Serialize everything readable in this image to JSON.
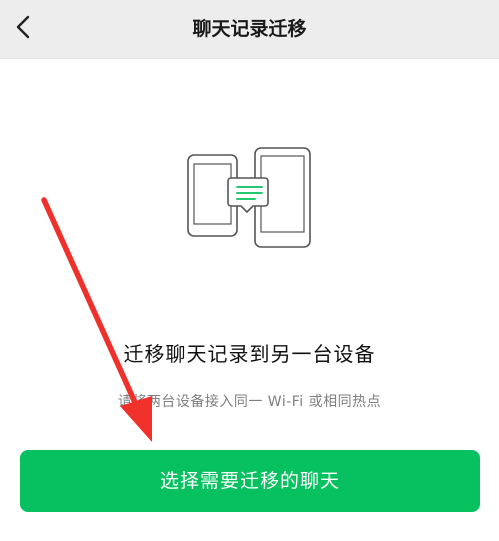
{
  "header": {
    "title": "聊天记录迁移",
    "back_icon": "chevron-left-icon"
  },
  "illustration": {
    "icon": "two-phones-transfer-icon",
    "accent_color": "#07c160"
  },
  "main": {
    "heading": "迁移聊天记录到另一台设备",
    "subtext": "请将两台设备接入同一 Wi-Fi 或相同热点"
  },
  "action": {
    "button_label": "选择需要迁移的聊天",
    "button_color": "#07c160"
  },
  "annotation": {
    "arrow_color": "#f0302a"
  }
}
